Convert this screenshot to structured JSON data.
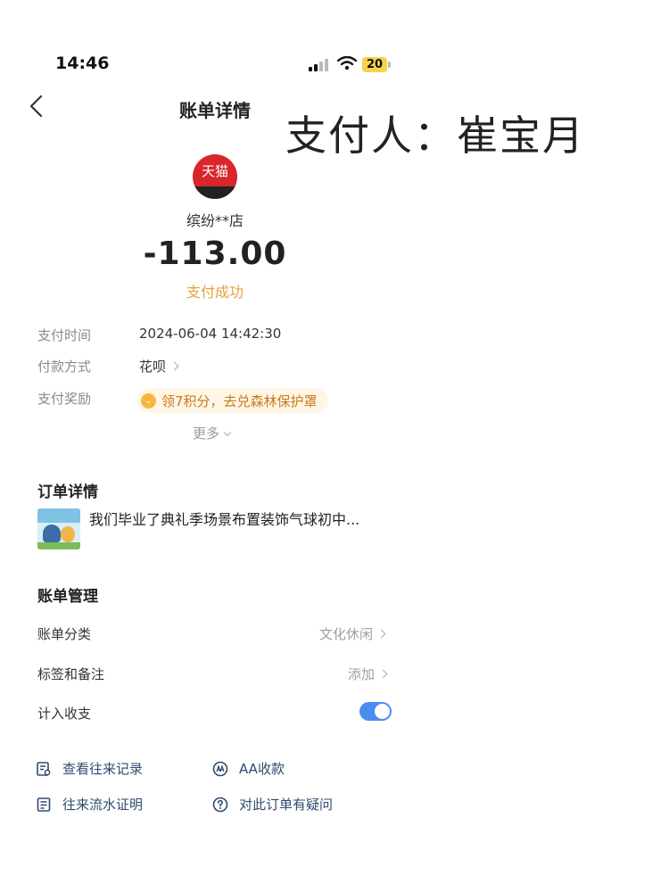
{
  "status_bar": {
    "time": "14:46",
    "battery": "20"
  },
  "nav": {
    "title": "账单详情"
  },
  "overlay_text": "支付人：崔宝月",
  "merchant": {
    "logo_text": "天猫",
    "name": "缤纷**店",
    "amount": "-113.00",
    "status": "支付成功"
  },
  "info": {
    "pay_time_label": "支付时间",
    "pay_time_value": "2024-06-04 14:42:30",
    "pay_method_label": "付款方式",
    "pay_method_value": "花呗",
    "reward_label": "支付奖励",
    "reward_value": "领7积分，去兑森林保护罩",
    "more_label": "更多"
  },
  "order": {
    "section_title": "订单详情",
    "item_name": "我们毕业了典礼季场景布置装饰气球初中..."
  },
  "management": {
    "section_title": "账单管理",
    "category_label": "账单分类",
    "category_value": "文化休闲",
    "tags_label": "标签和备注",
    "tags_value": "添加",
    "count_label": "计入收支",
    "count_enabled": true
  },
  "links": {
    "history": "查看往来记录",
    "aa": "AA收款",
    "proof": "往来流水证明",
    "question": "对此订单有疑问"
  },
  "colors": {
    "accent_blue": "#4b8cf0",
    "status_orange": "#e6a23c",
    "link_blue": "#2d4a72",
    "brand_red": "#d8262c"
  }
}
